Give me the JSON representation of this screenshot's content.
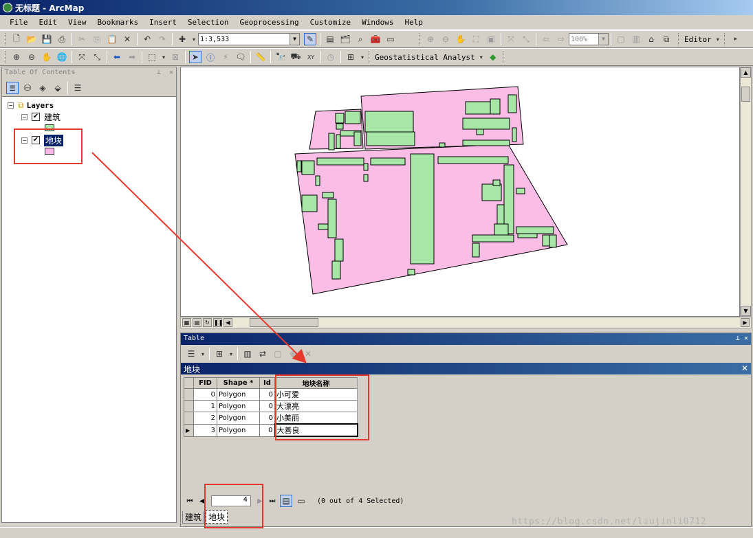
{
  "window": {
    "title": "无标题 - ArcMap"
  },
  "menu": [
    "File",
    "Edit",
    "View",
    "Bookmarks",
    "Insert",
    "Selection",
    "Geoprocessing",
    "Customize",
    "Windows",
    "Help"
  ],
  "toolbar": {
    "scale": "1:3,533",
    "zoom_percent": "100%",
    "editor_label": "Editor",
    "geostat_label": "Geostatistical Analyst"
  },
  "toc": {
    "title": "Table Of Contents",
    "root_label": "Layers",
    "layers": [
      {
        "label": "建筑",
        "checked": true,
        "swatch_color": "#a8e8a8",
        "selected": false
      },
      {
        "label": "地块",
        "checked": true,
        "swatch_color": "#f7b8e8",
        "selected": true
      }
    ]
  },
  "map": {
    "parcel_fill": "#f9bde6",
    "building_fill": "#a8e6a8",
    "outline": "#000000"
  },
  "table": {
    "window_title": "Table",
    "layer_name": "地块",
    "columns": [
      "FID",
      "Shape *",
      "Id",
      "地块名称"
    ],
    "rows": [
      [
        "0",
        "Polygon",
        "0",
        "小可爱"
      ],
      [
        "1",
        "Polygon",
        "0",
        "大漂亮"
      ],
      [
        "2",
        "Polygon",
        "0",
        "小美丽"
      ],
      [
        "3",
        "Polygon",
        "0",
        "大善良"
      ]
    ],
    "current_record": "4",
    "selection_status": "(0 out of 4 Selected)",
    "tabs": [
      "建筑",
      "地块"
    ],
    "active_tab": "地块"
  },
  "watermark": "https://blog.csdn.net/liujinli0712",
  "annotation_color": "#e8372c"
}
